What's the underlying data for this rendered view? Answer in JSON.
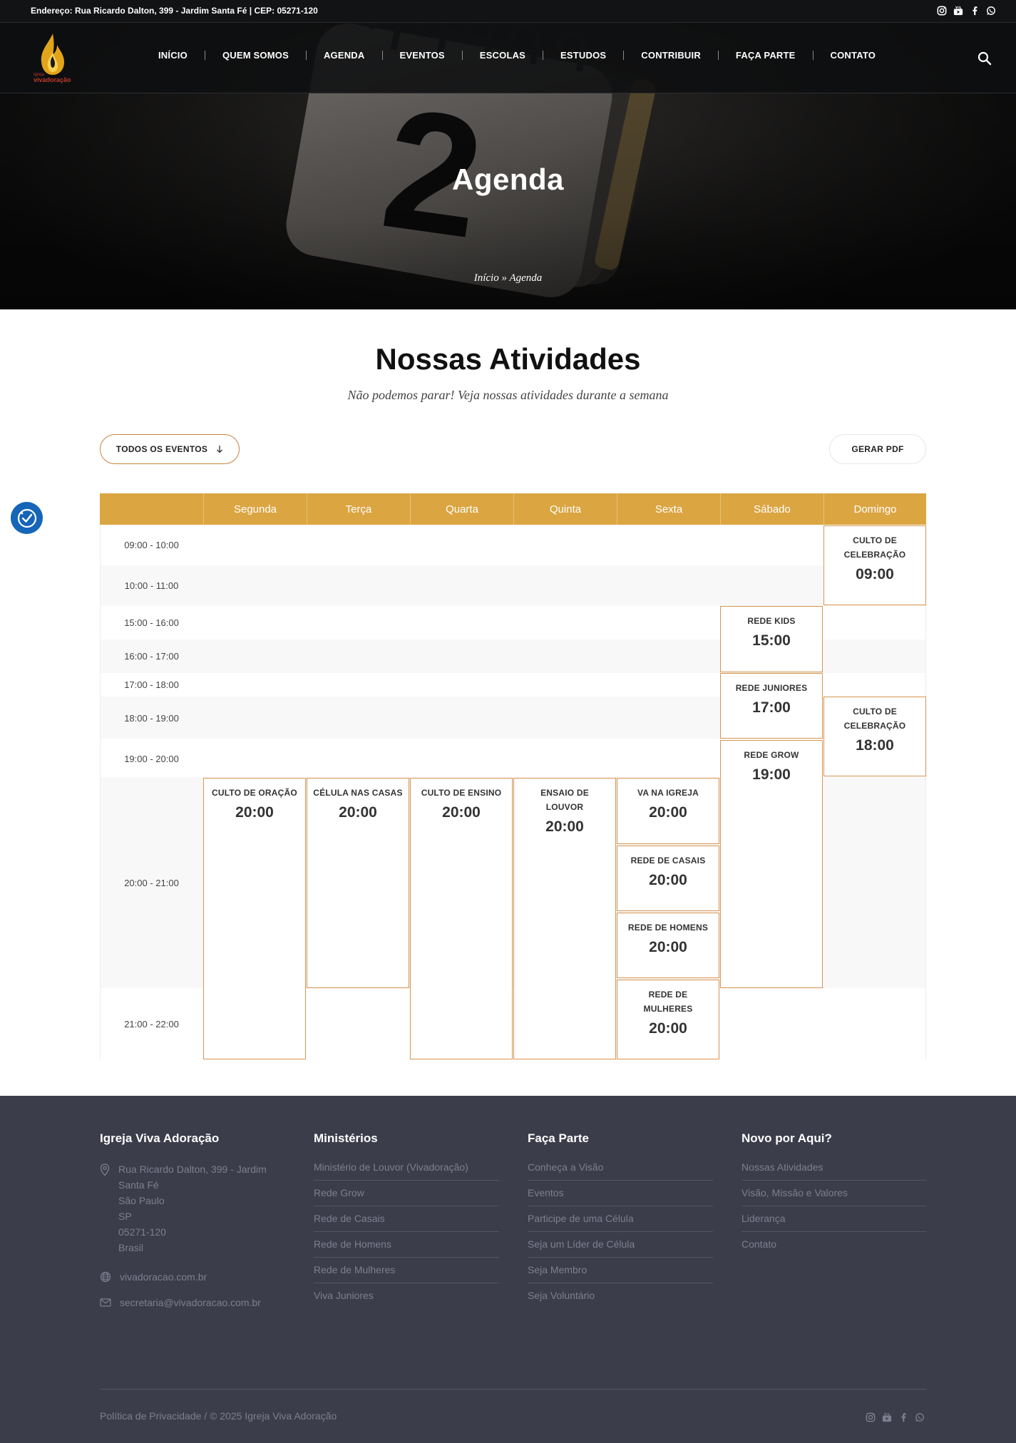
{
  "topbar": {
    "address": "Endereço: Rua Ricardo Dalton, 399 - Jardim Santa Fé | CEP: 05271-120",
    "social": [
      "instagram-icon",
      "youtube-icon",
      "facebook-icon",
      "whatsapp-icon"
    ]
  },
  "logo": {
    "line1": "Igreja",
    "line2": "vivadoração"
  },
  "nav": {
    "items": [
      "INÍCIO",
      "QUEM SOMOS",
      "AGENDA",
      "EVENTOS",
      "ESCOLAS",
      "ESTUDOS",
      "CONTRIBUIR",
      "FAÇA PARTE",
      "CONTATO"
    ]
  },
  "hero": {
    "title": "Agenda",
    "breadcrumb_home": "Início",
    "breadcrumb_sep": "»",
    "breadcrumb_current": "Agenda",
    "calendar_digit": "2"
  },
  "section": {
    "title": "Nossas Atividades",
    "subtitle": "Não podemos parar! Veja nossas atividades durante a semana"
  },
  "controls": {
    "filter_label": "TODOS OS EVENTOS",
    "pdf_label": "GERAR PDF"
  },
  "schedule": {
    "days": [
      "Segunda",
      "Terça",
      "Quarta",
      "Quinta",
      "Sexta",
      "Sábado",
      "Domingo"
    ],
    "slots": [
      "09:00 - 10:00",
      "10:00 - 11:00",
      "15:00 - 16:00",
      "16:00 - 17:00",
      "17:00 - 18:00",
      "18:00 - 19:00",
      "19:00 - 20:00",
      "20:00 - 21:00",
      "21:00 - 22:00"
    ],
    "events": [
      {
        "day": "Domingo",
        "title": "CULTO DE CELEBRAÇÃO",
        "time": "09:00"
      },
      {
        "day": "Sábado",
        "title": "REDE KIDS",
        "time": "15:00"
      },
      {
        "day": "Sábado",
        "title": "REDE JUNIORES",
        "time": "17:00"
      },
      {
        "day": "Domingo",
        "title": "CULTO DE CELEBRAÇÃO",
        "time": "18:00"
      },
      {
        "day": "Sábado",
        "title": "REDE GROW",
        "time": "19:00"
      },
      {
        "day": "Segunda",
        "title": "CULTO DE ORAÇÃO",
        "time": "20:00"
      },
      {
        "day": "Terça",
        "title": "CÉLULA NAS CASAS",
        "time": "20:00"
      },
      {
        "day": "Quarta",
        "title": "CULTO DE ENSINO",
        "time": "20:00"
      },
      {
        "day": "Quinta",
        "title": "ENSAIO DE LOUVOR",
        "time": "20:00"
      },
      {
        "day": "Sexta",
        "title": "VA NA IGREJA",
        "time": "20:00"
      },
      {
        "day": "Sexta",
        "title": "REDE DE CASAIS",
        "time": "20:00"
      },
      {
        "day": "Sexta",
        "title": "REDE DE HOMENS",
        "time": "20:00"
      },
      {
        "day": "Sexta",
        "title": "REDE DE MULHERES",
        "time": "20:00"
      }
    ]
  },
  "footer": {
    "col1": {
      "title": "Igreja Viva Adoração",
      "address_lines": [
        "Rua Ricardo Dalton, 399 - Jardim",
        "Santa Fé",
        "São Paulo",
        "SP",
        "05271-120",
        "Brasil"
      ],
      "website": "vivadoracao.com.br",
      "email": "secretaria@vivadoracao.com.br"
    },
    "col2": {
      "title": "Ministérios",
      "links": [
        "Ministério de Louvor (Vivadoração)",
        "Rede Grow",
        "Rede de Casais",
        "Rede de Homens",
        "Rede de Mulheres",
        "Viva Juniores"
      ]
    },
    "col3": {
      "title": "Faça Parte",
      "links": [
        "Conheça a Visão",
        "Eventos",
        "Participe de uma Célula",
        "Seja um Líder de Célula",
        "Seja Membro",
        "Seja Voluntário"
      ]
    },
    "col4": {
      "title": "Novo por Aqui?",
      "links": [
        "Nossas Atividades",
        "Visão, Missão e Valores",
        "Liderança",
        "Contato"
      ]
    },
    "copyright": "Política de Privacidade / © 2025 Igreja Viva Adoração"
  },
  "colors": {
    "accent": "#dba542",
    "event_border": "#d79450",
    "footer_bg": "#3c3d4b",
    "topbar_bg": "#121314"
  }
}
